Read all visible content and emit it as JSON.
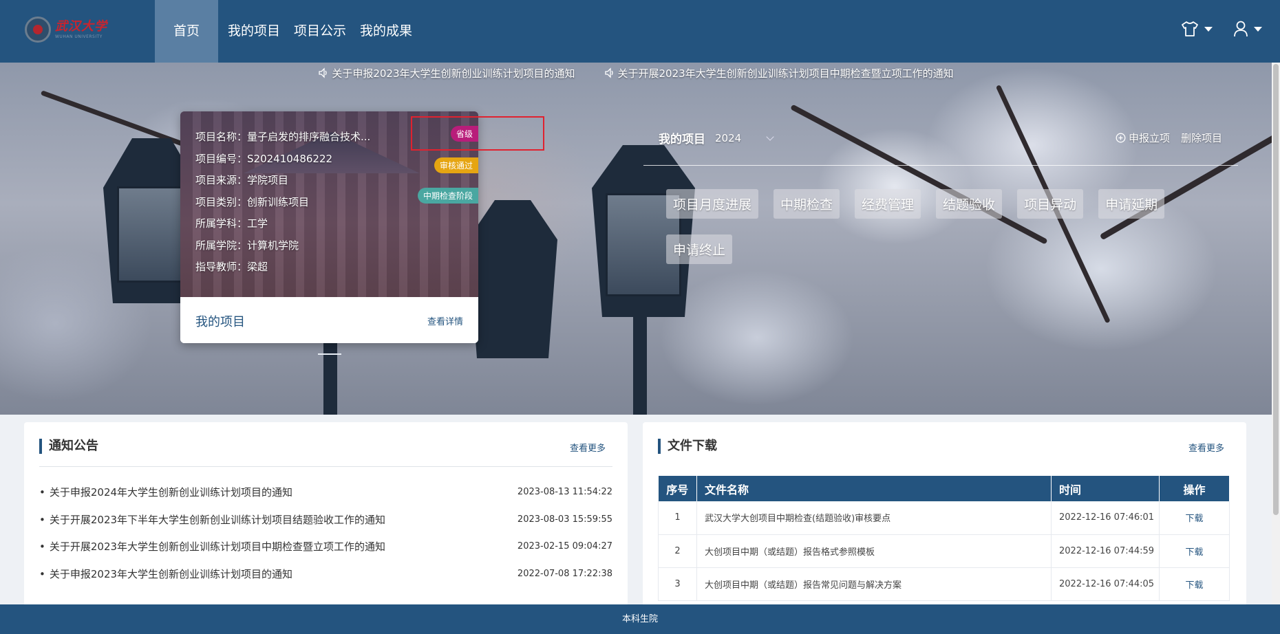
{
  "header": {
    "logo_cn": "武汉大学",
    "logo_en": "WUHAN UNIVERSITY",
    "nav": [
      "首页",
      "我的项目",
      "项目公示",
      "我的成果"
    ],
    "icons": {
      "theme": "tshirt-icon",
      "user": "user-icon"
    }
  },
  "ticker": [
    "关于申报2023年大学生创新创业训练计划项目的通知",
    "关于开展2023年大学生创新创业训练计划项目中期检查暨立项工作的通知"
  ],
  "project_card": {
    "rows": [
      "项目名称：量子启发的排序融合技术...",
      "项目编号：S202410486222",
      "项目来源：学院项目",
      "项目类别：创新训练项目",
      "所属学科：工学",
      "所属学院：计算机学院",
      "指导教师：梁超"
    ],
    "badges": {
      "level": "省级",
      "status": "审核通过",
      "stage": "中期检查阶段"
    },
    "footer_title": "我的项目",
    "footer_link": "查看详情"
  },
  "my_project": {
    "title": "我的项目",
    "year": "2024",
    "apply": "申报立项",
    "delete": "删除项目",
    "actions": [
      "项目月度进展",
      "中期检查",
      "经费管理",
      "结题验收",
      "项目异动",
      "申请延期",
      "申请终止"
    ]
  },
  "notice": {
    "title": "通知公告",
    "more": "查看更多",
    "items": [
      {
        "text": "关于申报2024年大学生创新创业训练计划项目的通知",
        "date": "2023-08-13 11:54:22"
      },
      {
        "text": "关于开展2023年下半年大学生创新创业训练计划项目结题验收工作的通知",
        "date": "2023-08-03 15:59:55"
      },
      {
        "text": "关于开展2023年大学生创新创业训练计划项目中期检查暨立项工作的通知",
        "date": "2023-02-15 09:04:27"
      },
      {
        "text": "关于申报2023年大学生创新创业训练计划项目的通知",
        "date": "2022-07-08 17:22:38"
      }
    ]
  },
  "files": {
    "title": "文件下载",
    "more": "查看更多",
    "columns": [
      "序号",
      "文件名称",
      "时间",
      "操作"
    ],
    "rows": [
      {
        "no": "1",
        "name": "武汉大学大创项目中期检查(结题验收)审核要点",
        "time": "2022-12-16 07:46:01",
        "op": "下载"
      },
      {
        "no": "2",
        "name": "大创项目中期（或结题）报告格式参照模板",
        "time": "2022-12-16 07:44:59",
        "op": "下载"
      },
      {
        "no": "3",
        "name": "大创项目中期（或结题）报告常见问题与解决方案",
        "time": "2022-12-16 07:44:05",
        "op": "下载"
      }
    ]
  },
  "footer": {
    "text": "本科生院"
  }
}
